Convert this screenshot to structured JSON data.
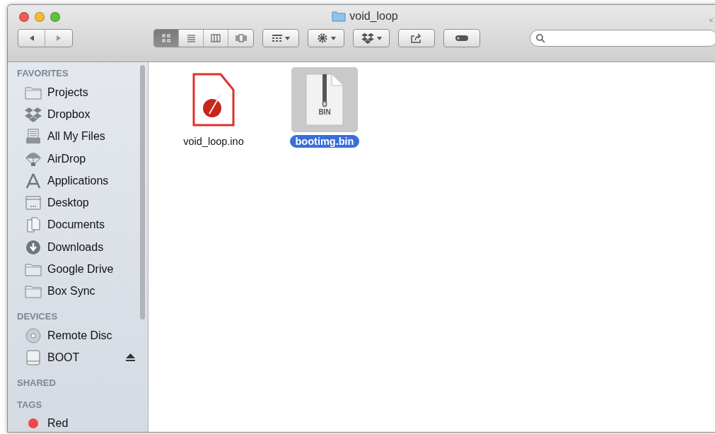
{
  "window": {
    "title": "void_loop"
  },
  "toolbar": {
    "view_modes": [
      {
        "kind": "icons",
        "selected": true
      },
      {
        "kind": "list",
        "selected": false
      },
      {
        "kind": "columns",
        "selected": false
      },
      {
        "kind": "coverflow",
        "selected": false
      }
    ]
  },
  "sidebar": {
    "sections": [
      {
        "heading": "FAVORITES",
        "items": [
          {
            "label": "Projects",
            "kind": "folder"
          },
          {
            "label": "Dropbox",
            "kind": "dropbox"
          },
          {
            "label": "All My Files",
            "kind": "files"
          },
          {
            "label": "AirDrop",
            "kind": "airdrop"
          },
          {
            "label": "Applications",
            "kind": "apps"
          },
          {
            "label": "Desktop",
            "kind": "desktop"
          },
          {
            "label": "Documents",
            "kind": "documents"
          },
          {
            "label": "Downloads",
            "kind": "downloads"
          },
          {
            "label": "Google Drive",
            "kind": "folder"
          },
          {
            "label": "Box Sync",
            "kind": "folder"
          }
        ]
      },
      {
        "heading": "DEVICES",
        "items": [
          {
            "label": "Remote Disc",
            "kind": "disc",
            "ejectable": false
          },
          {
            "label": "BOOT",
            "kind": "drive",
            "ejectable": true
          }
        ]
      },
      {
        "heading": "SHARED"
      },
      {
        "heading": "TAGS",
        "items": [
          {
            "label": "Red",
            "kind": "tag",
            "color": "#f04848"
          }
        ]
      }
    ]
  },
  "files": [
    {
      "name": "void_loop.ino",
      "kind": "sketch",
      "selected": false
    },
    {
      "name": "bootimg.bin",
      "kind": "archive",
      "badge": "BIN",
      "selected": true
    }
  ]
}
